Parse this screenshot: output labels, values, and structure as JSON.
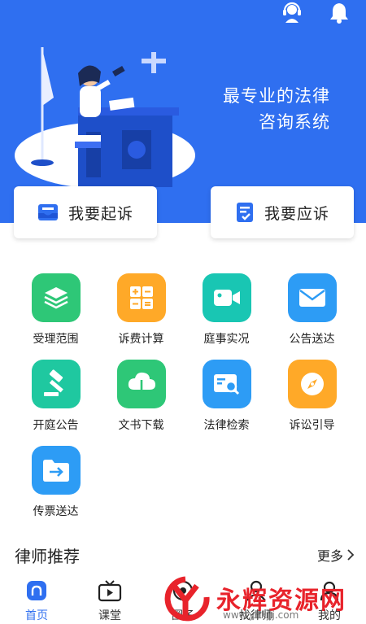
{
  "hero": {
    "slogan_line1": "最专业的法律",
    "slogan_line2": "咨询系统",
    "support_icon": "headset-icon",
    "bell_icon": "bell-icon"
  },
  "actions": [
    {
      "label": "我要起诉",
      "icon": "inbox-icon"
    },
    {
      "label": "我要应诉",
      "icon": "clipboard-check-icon"
    }
  ],
  "features": [
    {
      "label": "受理范围",
      "icon": "layers-icon",
      "color": "#2ec777"
    },
    {
      "label": "诉费计算",
      "icon": "calculator-icon",
      "color": "#ffa928"
    },
    {
      "label": "庭事实况",
      "icon": "video-icon",
      "color": "#19c6b3"
    },
    {
      "label": "公告送达",
      "icon": "mail-icon",
      "color": "#2d9cf5"
    },
    {
      "label": "开庭公告",
      "icon": "gavel-icon",
      "color": "#1fc8a0"
    },
    {
      "label": "文书下载",
      "icon": "cloud-download-icon",
      "color": "#2ec777"
    },
    {
      "label": "法律检索",
      "icon": "search-doc-icon",
      "color": "#2d9cf5"
    },
    {
      "label": "诉讼引导",
      "icon": "compass-icon",
      "color": "#ffa928"
    },
    {
      "label": "传票送达",
      "icon": "folder-arrow-icon",
      "color": "#2d9cf5"
    }
  ],
  "section": {
    "title": "律师推荐",
    "more": "更多"
  },
  "tabs": [
    {
      "label": "首页",
      "icon": "home-icon",
      "active": true
    },
    {
      "label": "课堂",
      "icon": "tv-icon",
      "active": false
    },
    {
      "label": "圈子",
      "icon": "circle-icon",
      "active": false
    },
    {
      "label": "找律师",
      "icon": "lawyer-icon",
      "active": false
    },
    {
      "label": "我的",
      "icon": "user-icon",
      "active": false
    }
  ],
  "watermark": {
    "title": "永辉资源网",
    "url": "www.yhkjjj.com"
  },
  "colors": {
    "primary": "#2f6ff0",
    "watermark": "#e8232b"
  }
}
